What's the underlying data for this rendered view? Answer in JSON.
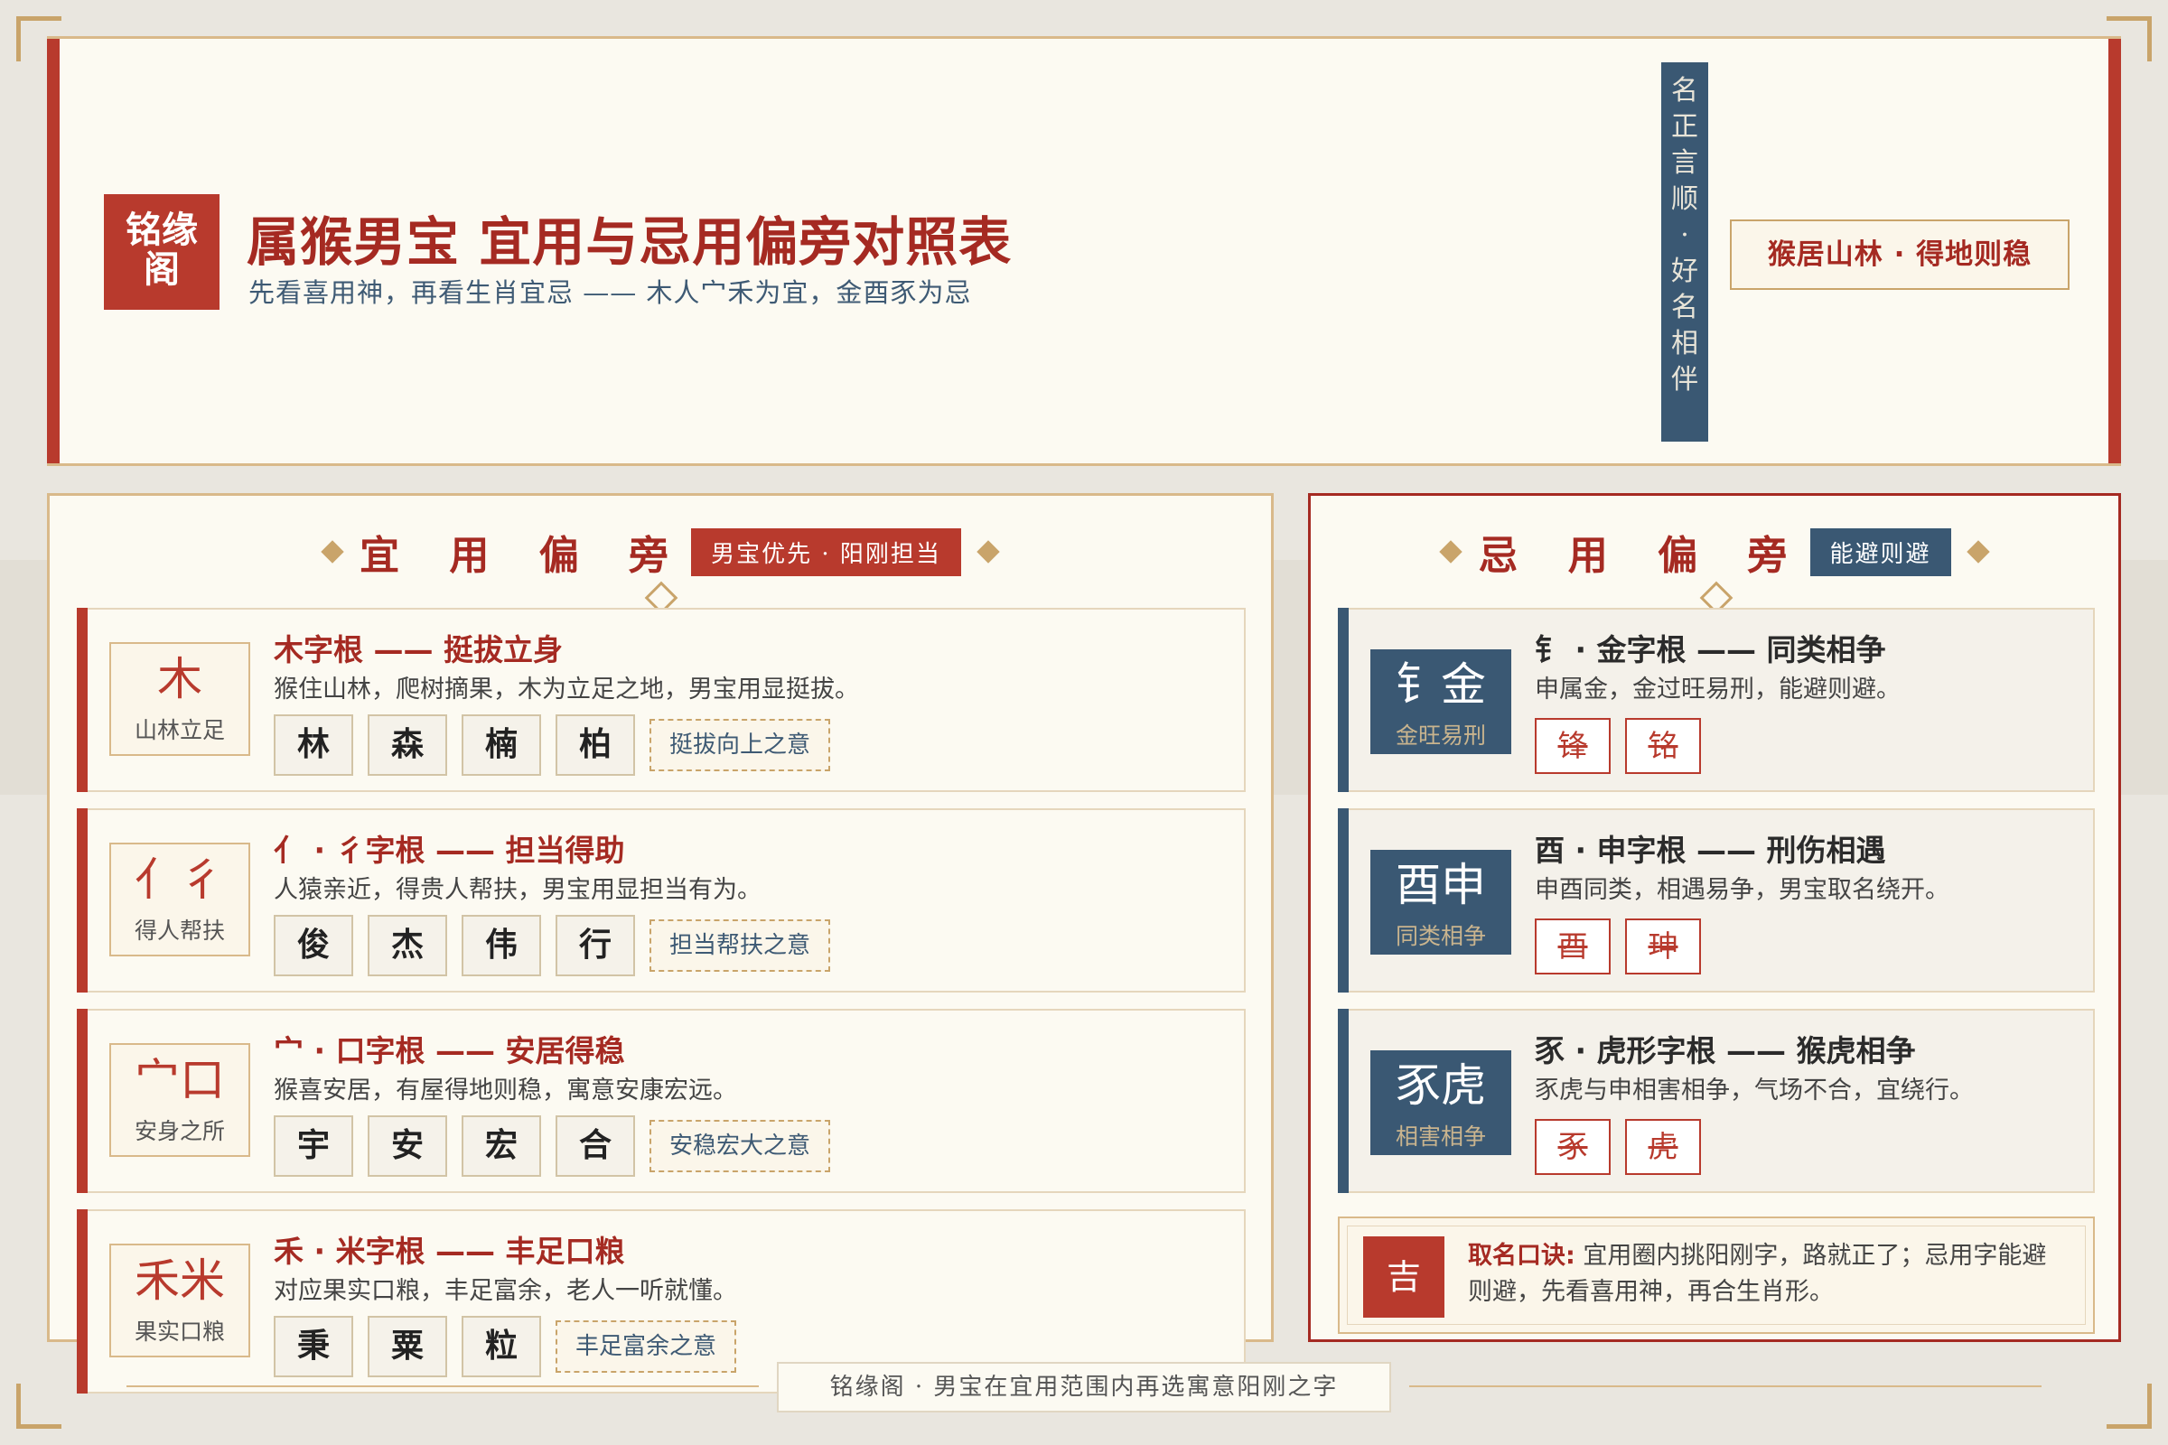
{
  "header": {
    "logo": "铭缘阁",
    "title": "属猴男宝 宜用与忌用偏旁对照表",
    "subtitle": "先看喜用神，再看生肖宜忌 —— 木人宀禾为宜，金酉豕为忌",
    "vertical_banner": [
      "名",
      "正",
      "言",
      "顺",
      "·",
      "好",
      "名",
      "相",
      "伴"
    ],
    "motto": "猴居山林 · 得地则稳"
  },
  "good": {
    "title": "宜 用 偏 旁",
    "tag": "男宝优先 · 阳刚担当",
    "cards": [
      {
        "glyph": "木",
        "glyph_desc": "山林立足",
        "title": "木字根 —— 挺拔立身",
        "desc": "猴住山林，爬树摘果，木为立足之地，男宝用显挺拔。",
        "chars": [
          "林",
          "森",
          "楠",
          "柏"
        ],
        "meaning": "挺拔向上之意"
      },
      {
        "glyph": "亻彳",
        "glyph_desc": "得人帮扶",
        "title": "亻 · 彳字根 —— 担当得助",
        "desc": "人猿亲近，得贵人帮扶，男宝用显担当有为。",
        "chars": [
          "俊",
          "杰",
          "伟",
          "行"
        ],
        "meaning": "担当帮扶之意"
      },
      {
        "glyph": "宀口",
        "glyph_desc": "安身之所",
        "title": "宀 · 口字根 —— 安居得稳",
        "desc": "猴喜安居，有屋得地则稳，寓意安康宏远。",
        "chars": [
          "宇",
          "安",
          "宏",
          "合"
        ],
        "meaning": "安稳宏大之意"
      },
      {
        "glyph": "禾米",
        "glyph_desc": "果实口粮",
        "title": "禾 · 米字根 —— 丰足口粮",
        "desc": "对应果实口粮，丰足富余，老人一听就懂。",
        "chars": [
          "秉",
          "粟",
          "粒"
        ],
        "meaning": "丰足富余之意"
      }
    ]
  },
  "bad": {
    "title": "忌 用 偏 旁",
    "tag": "能避则避",
    "cards": [
      {
        "glyph": "钅金",
        "glyph_desc": "金旺易刑",
        "title": "钅 · 金字根 —— 同类相争",
        "desc": "申属金，金过旺易刑，能避则避。",
        "chars": [
          "锋",
          "铭"
        ]
      },
      {
        "glyph": "酉申",
        "glyph_desc": "同类相争",
        "title": "酉 · 申字根 —— 刑伤相遇",
        "desc": "申酉同类，相遇易争，男宝取名绕开。",
        "chars": [
          "酉",
          "珅"
        ]
      },
      {
        "glyph": "豕虎",
        "glyph_desc": "相害相争",
        "title": "豕 · 虎形字根 —— 猴虎相争",
        "desc": "豕虎与申相害相争，气场不合，宜绕行。",
        "chars": [
          "豕",
          "虎"
        ]
      }
    ],
    "formula": {
      "badge": "吉",
      "label": "取名口诀:",
      "text": "宜用圈内挑阳刚字，路就正了；忌用字能避则避，先看喜用神，再合生肖形。"
    }
  },
  "footer": "铭缘阁 · 男宝在宜用范围内再选寓意阳刚之字"
}
